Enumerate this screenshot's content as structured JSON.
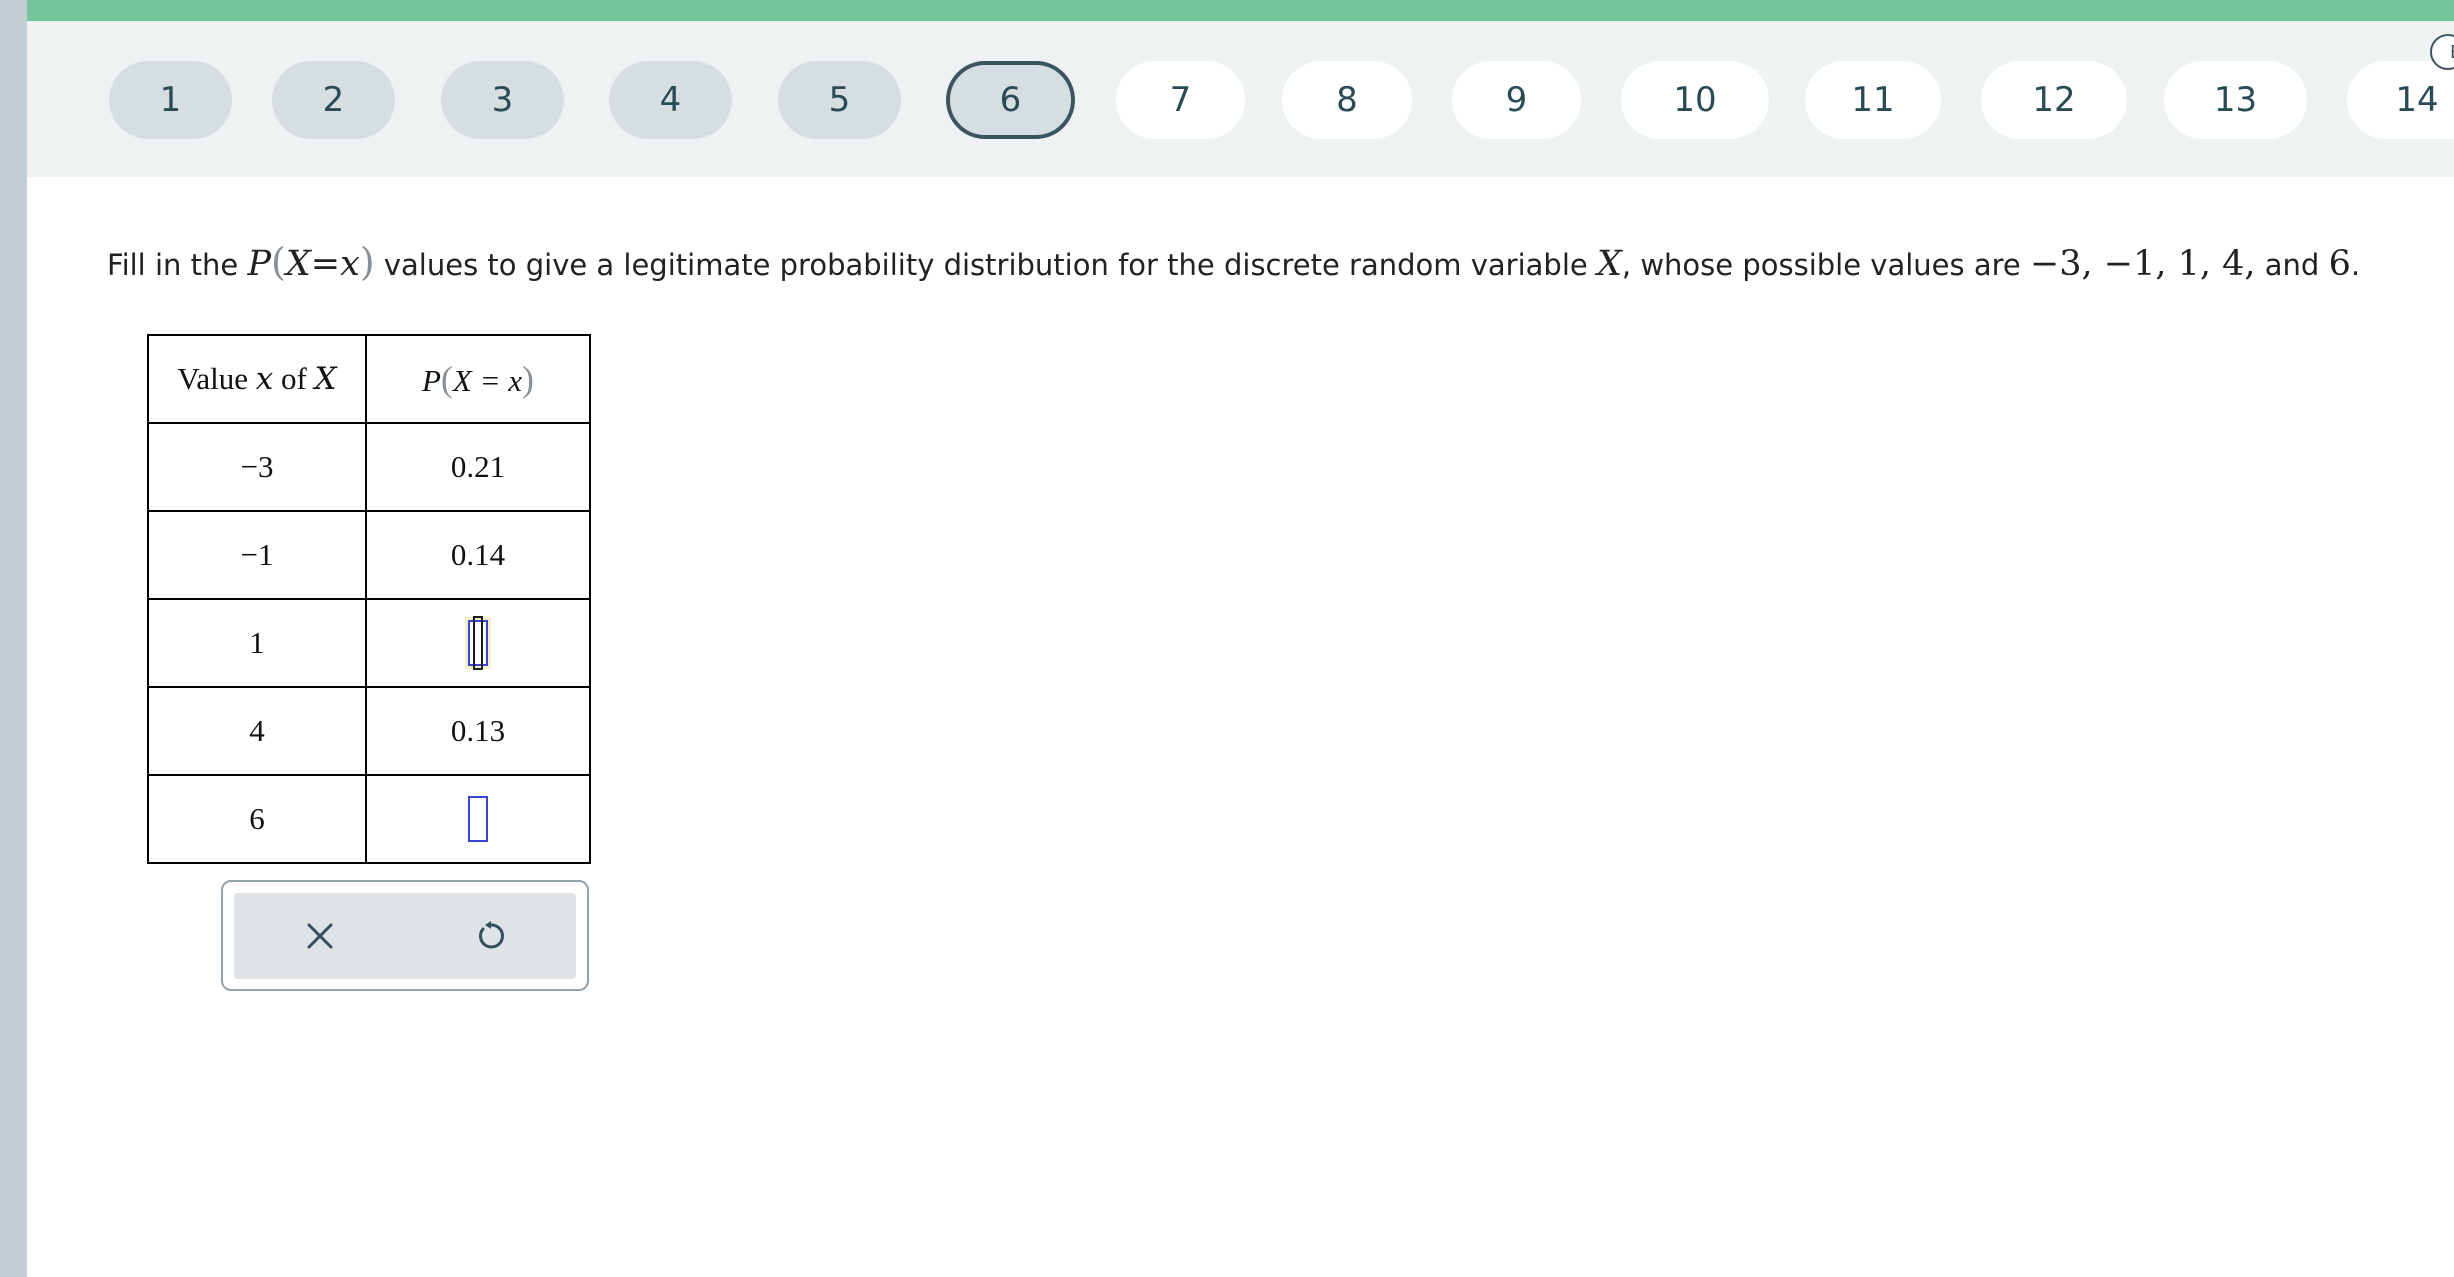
{
  "nav": {
    "items": [
      {
        "label": "1",
        "state": "done"
      },
      {
        "label": "2",
        "state": "done"
      },
      {
        "label": "3",
        "state": "done"
      },
      {
        "label": "4",
        "state": "done"
      },
      {
        "label": "5",
        "state": "done"
      },
      {
        "label": "6",
        "state": "current"
      },
      {
        "label": "7",
        "state": "todo"
      },
      {
        "label": "8",
        "state": "todo"
      },
      {
        "label": "9",
        "state": "todo"
      },
      {
        "label": "10",
        "state": "todo"
      },
      {
        "label": "11",
        "state": "todo"
      },
      {
        "label": "12",
        "state": "todo"
      },
      {
        "label": "13",
        "state": "todo"
      },
      {
        "label": "14",
        "state": "todo"
      }
    ],
    "badge": "E"
  },
  "question": {
    "t1": "Fill in the ",
    "p": "P",
    "open": "(",
    "xeqx": "X=x",
    "close": ")",
    "t2": " values to give a legitimate probability distribution for the discrete random variable ",
    "var": "X",
    "t3": ", whose possible values are ",
    "vals": "−3, −1, 1, 4,",
    "t4": " and ",
    "last": "6",
    "t5": "."
  },
  "table": {
    "header": {
      "col1_a": "Value ",
      "col1_x": "x",
      "col1_b": " of ",
      "col1_X": "X",
      "col2_p": "P",
      "col2_open": "(",
      "col2_mid": "X = x",
      "col2_close": ")"
    },
    "rows": [
      {
        "x": "−3",
        "p": "0.21"
      },
      {
        "x": "−1",
        "p": "0.14"
      },
      {
        "x": "1",
        "p": ""
      },
      {
        "x": "4",
        "p": "0.13"
      },
      {
        "x": "6",
        "p": ""
      }
    ]
  },
  "toolbar": {
    "clear_icon": "close-icon",
    "reset_icon": "undo-icon"
  },
  "colors": {
    "accent": "#74c49c",
    "nav_current_border": "#3b5560",
    "input_border": "#3a45d6"
  }
}
